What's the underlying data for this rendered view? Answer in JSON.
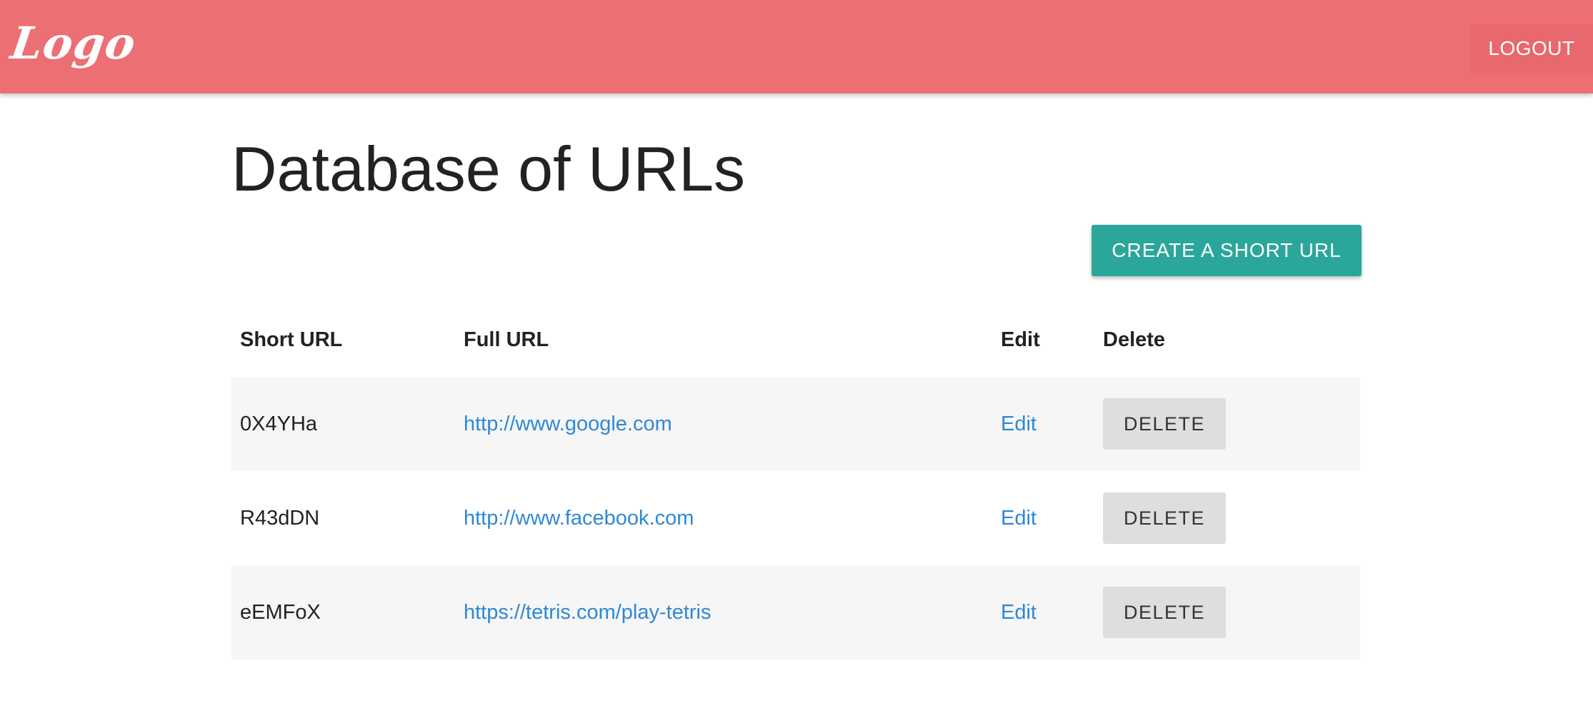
{
  "header": {
    "logo": "Logo",
    "logout_label": "LOGOUT",
    "background": "#ec6f74"
  },
  "main": {
    "title": "Database of URLs",
    "create_label": "CREATE A SHORT URL",
    "create_color": "#2ba69a"
  },
  "table": {
    "headers": {
      "short": "Short URL",
      "full": "Full URL",
      "edit": "Edit",
      "delete": "Delete"
    },
    "rows": [
      {
        "short": "0X4YHa",
        "full": "http://www.google.com",
        "edit": "Edit",
        "delete": "DELETE"
      },
      {
        "short": "R43dDN",
        "full": "http://www.facebook.com",
        "edit": "Edit",
        "delete": "DELETE"
      },
      {
        "short": "eEMFoX",
        "full": "https://tetris.com/play-tetris",
        "edit": "Edit",
        "delete": "DELETE"
      }
    ],
    "link_color": "#2f88d4"
  }
}
